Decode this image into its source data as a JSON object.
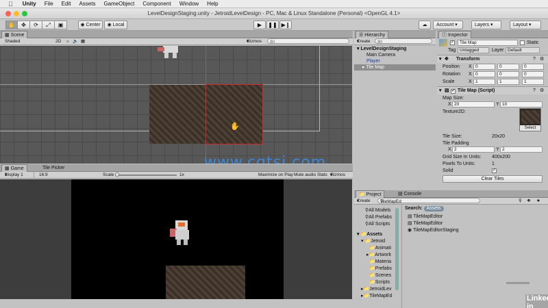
{
  "menubar": {
    "app": "Unity",
    "items": [
      "File",
      "Edit",
      "Assets",
      "GameObject",
      "Component",
      "Window",
      "Help"
    ]
  },
  "window": {
    "title": "LevelDesignStaging.unity - JetroidLevelDesign - PC, Mac & Linux Standalone (Personal) <OpenGL 4.1>"
  },
  "toolbar": {
    "pivot": "Center",
    "space": "Local",
    "account": "Account",
    "layers": "Layers",
    "layout": "Layout"
  },
  "scene": {
    "tab": "Scene",
    "shading": "Shaded",
    "mode_2d": "2D",
    "gizmos": "Gizmos",
    "search_placeholder": "All"
  },
  "game": {
    "tab": "Game",
    "tab2": "Tile Picker",
    "display": "Display 1",
    "aspect": "16:9",
    "scale_label": "Scale",
    "scale_value": "1x",
    "maximize": "Maximize on Play",
    "mute": "Mute audio",
    "stats": "Stats",
    "gizmos": "Gizmos"
  },
  "hierarchy": {
    "tab": "Hierarchy",
    "create": "Create",
    "search_placeholder": "All",
    "scene_name": "LevelDesignStaging",
    "items": [
      "Main Camera",
      "Player",
      "Tile Map"
    ]
  },
  "inspector": {
    "tab": "Inspector",
    "object_name": "Tile Map",
    "static_label": "Static",
    "tag_label": "Tag",
    "tag_value": "Untagged",
    "layer_label": "Layer",
    "layer_value": "Default",
    "transform": {
      "title": "Transform",
      "rows": [
        {
          "label": "Position",
          "x": "0",
          "y": "0",
          "z": "0"
        },
        {
          "label": "Rotation",
          "x": "0",
          "y": "0",
          "z": "0"
        },
        {
          "label": "Scale",
          "x": "1",
          "y": "1",
          "z": "1"
        }
      ]
    },
    "tilemap": {
      "title": "Tile Map (Script)",
      "map_size_label": "Map Size:",
      "map_x": "20",
      "map_y": "10",
      "texture_label": "Texture2D:",
      "select": "Select",
      "tile_size_label": "Tile Size:",
      "tile_size_value": "20x20",
      "padding_label": "Tile Padding",
      "pad_x": "2",
      "pad_y": "2",
      "grid_label": "Grid Size In Units:",
      "grid_value": "400x200",
      "ptu_label": "Pixels To Units:",
      "ptu_value": "1",
      "solid_label": "Solid",
      "clear_button": "Clear Tiles"
    },
    "axis_x": "X",
    "axis_y": "Y",
    "axis_z": "Z"
  },
  "project": {
    "tab": "Project",
    "tab2": "Console",
    "create": "Create",
    "search_value": "TileMapEd",
    "search_label": "Search:",
    "search_scope": "Assets",
    "favorites": [
      "All Models",
      "All Prefabs",
      "All Scripts"
    ],
    "assets_root": "Assets",
    "tree": [
      "Jetroid",
      "Animati",
      "Artwork",
      "Materia",
      "Prefabs",
      "Scenes",
      "Scripts",
      "JetroidLev",
      "TileMapEd"
    ],
    "results": [
      "TileMapEditor",
      "TileMapEditor",
      "TileMapEditorStaging"
    ]
  },
  "watermark": {
    "site": "www.cgtsj.com",
    "brand": "Linked in"
  }
}
